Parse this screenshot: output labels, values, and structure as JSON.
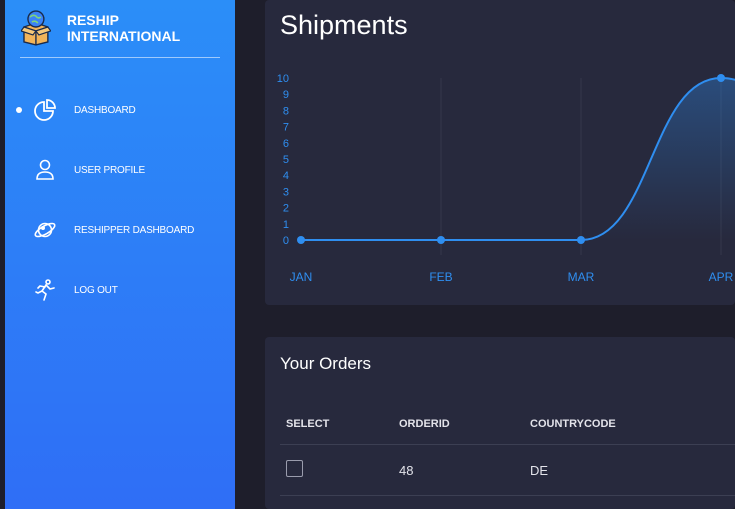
{
  "brand": {
    "name": "RESHIP INTERNATIONAL",
    "logo_icon": "box-globe-icon"
  },
  "sidebar": {
    "items": [
      {
        "label": "DASHBOARD",
        "icon": "pie-chart-icon",
        "active": true
      },
      {
        "label": "USER PROFILE",
        "icon": "user-icon",
        "active": false
      },
      {
        "label": "RESHIPPER DASHBOARD",
        "icon": "planet-icon",
        "active": false
      },
      {
        "label": "LOG OUT",
        "icon": "running-person-icon",
        "active": false
      }
    ]
  },
  "shipments": {
    "title": "Shipments",
    "chart_data": {
      "type": "area",
      "categories": [
        "JAN",
        "FEB",
        "MAR",
        "APR"
      ],
      "series": [
        {
          "values": [
            0,
            0,
            0,
            10
          ]
        }
      ],
      "ylim": [
        0,
        10
      ],
      "yticks": [
        "0",
        "1",
        "2",
        "3",
        "4",
        "5",
        "6",
        "7",
        "8",
        "9",
        "10"
      ],
      "title": "",
      "xlabel": "",
      "ylabel": "",
      "grid": "vertical",
      "line_color": "#2f8ef0",
      "tick_color": "#2f8ef0"
    }
  },
  "orders": {
    "title": "Your Orders",
    "columns": [
      "SELECT",
      "ORDERID",
      "COUNTRYCODE"
    ],
    "rows": [
      {
        "orderid": "48",
        "countrycode": "DE",
        "selected": false
      }
    ]
  },
  "colors": {
    "sidebar_top": "#2b8ef8",
    "sidebar_bottom": "#2f6ef6",
    "card": "#27293d",
    "page": "#1e1e2b"
  }
}
